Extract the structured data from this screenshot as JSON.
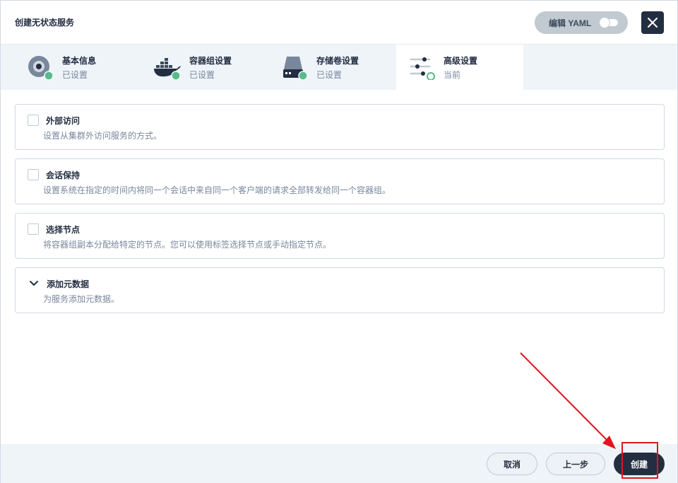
{
  "header": {
    "title": "创建无状态服务",
    "yaml_label": "编辑 YAML",
    "yaml_enabled": false,
    "close_icon": "close-icon"
  },
  "steps": [
    {
      "title": "基本信息",
      "status": "已设置",
      "icon": "basic-info-icon",
      "state": "done"
    },
    {
      "title": "容器组设置",
      "status": "已设置",
      "icon": "docker-icon",
      "state": "done"
    },
    {
      "title": "存储卷设置",
      "status": "已设置",
      "icon": "storage-icon",
      "state": "done"
    },
    {
      "title": "高级设置",
      "status": "当前",
      "icon": "settings-sliders-icon",
      "state": "current"
    }
  ],
  "options": [
    {
      "title": "外部访问",
      "description": "设置从集群外访问服务的方式。",
      "checked": false
    },
    {
      "title": "会话保持",
      "description": "设置系统在指定的时间内将同一个会话中来自同一个客户端的请求全部转发给同一个容器组。",
      "checked": false
    },
    {
      "title": "选择节点",
      "description": "将容器组副本分配给特定的节点。您可以使用标签选择节点或手动指定节点。",
      "checked": false
    },
    {
      "title": "添加元数据",
      "description": "为服务添加元数据。",
      "expandable": true
    }
  ],
  "footer": {
    "cancel_label": "取消",
    "prev_label": "上一步",
    "create_label": "创建"
  },
  "colors": {
    "primary": "#242e42",
    "success": "#55bc8a",
    "annotation": "#e0141e",
    "panel_bg": "#eff4f9"
  }
}
